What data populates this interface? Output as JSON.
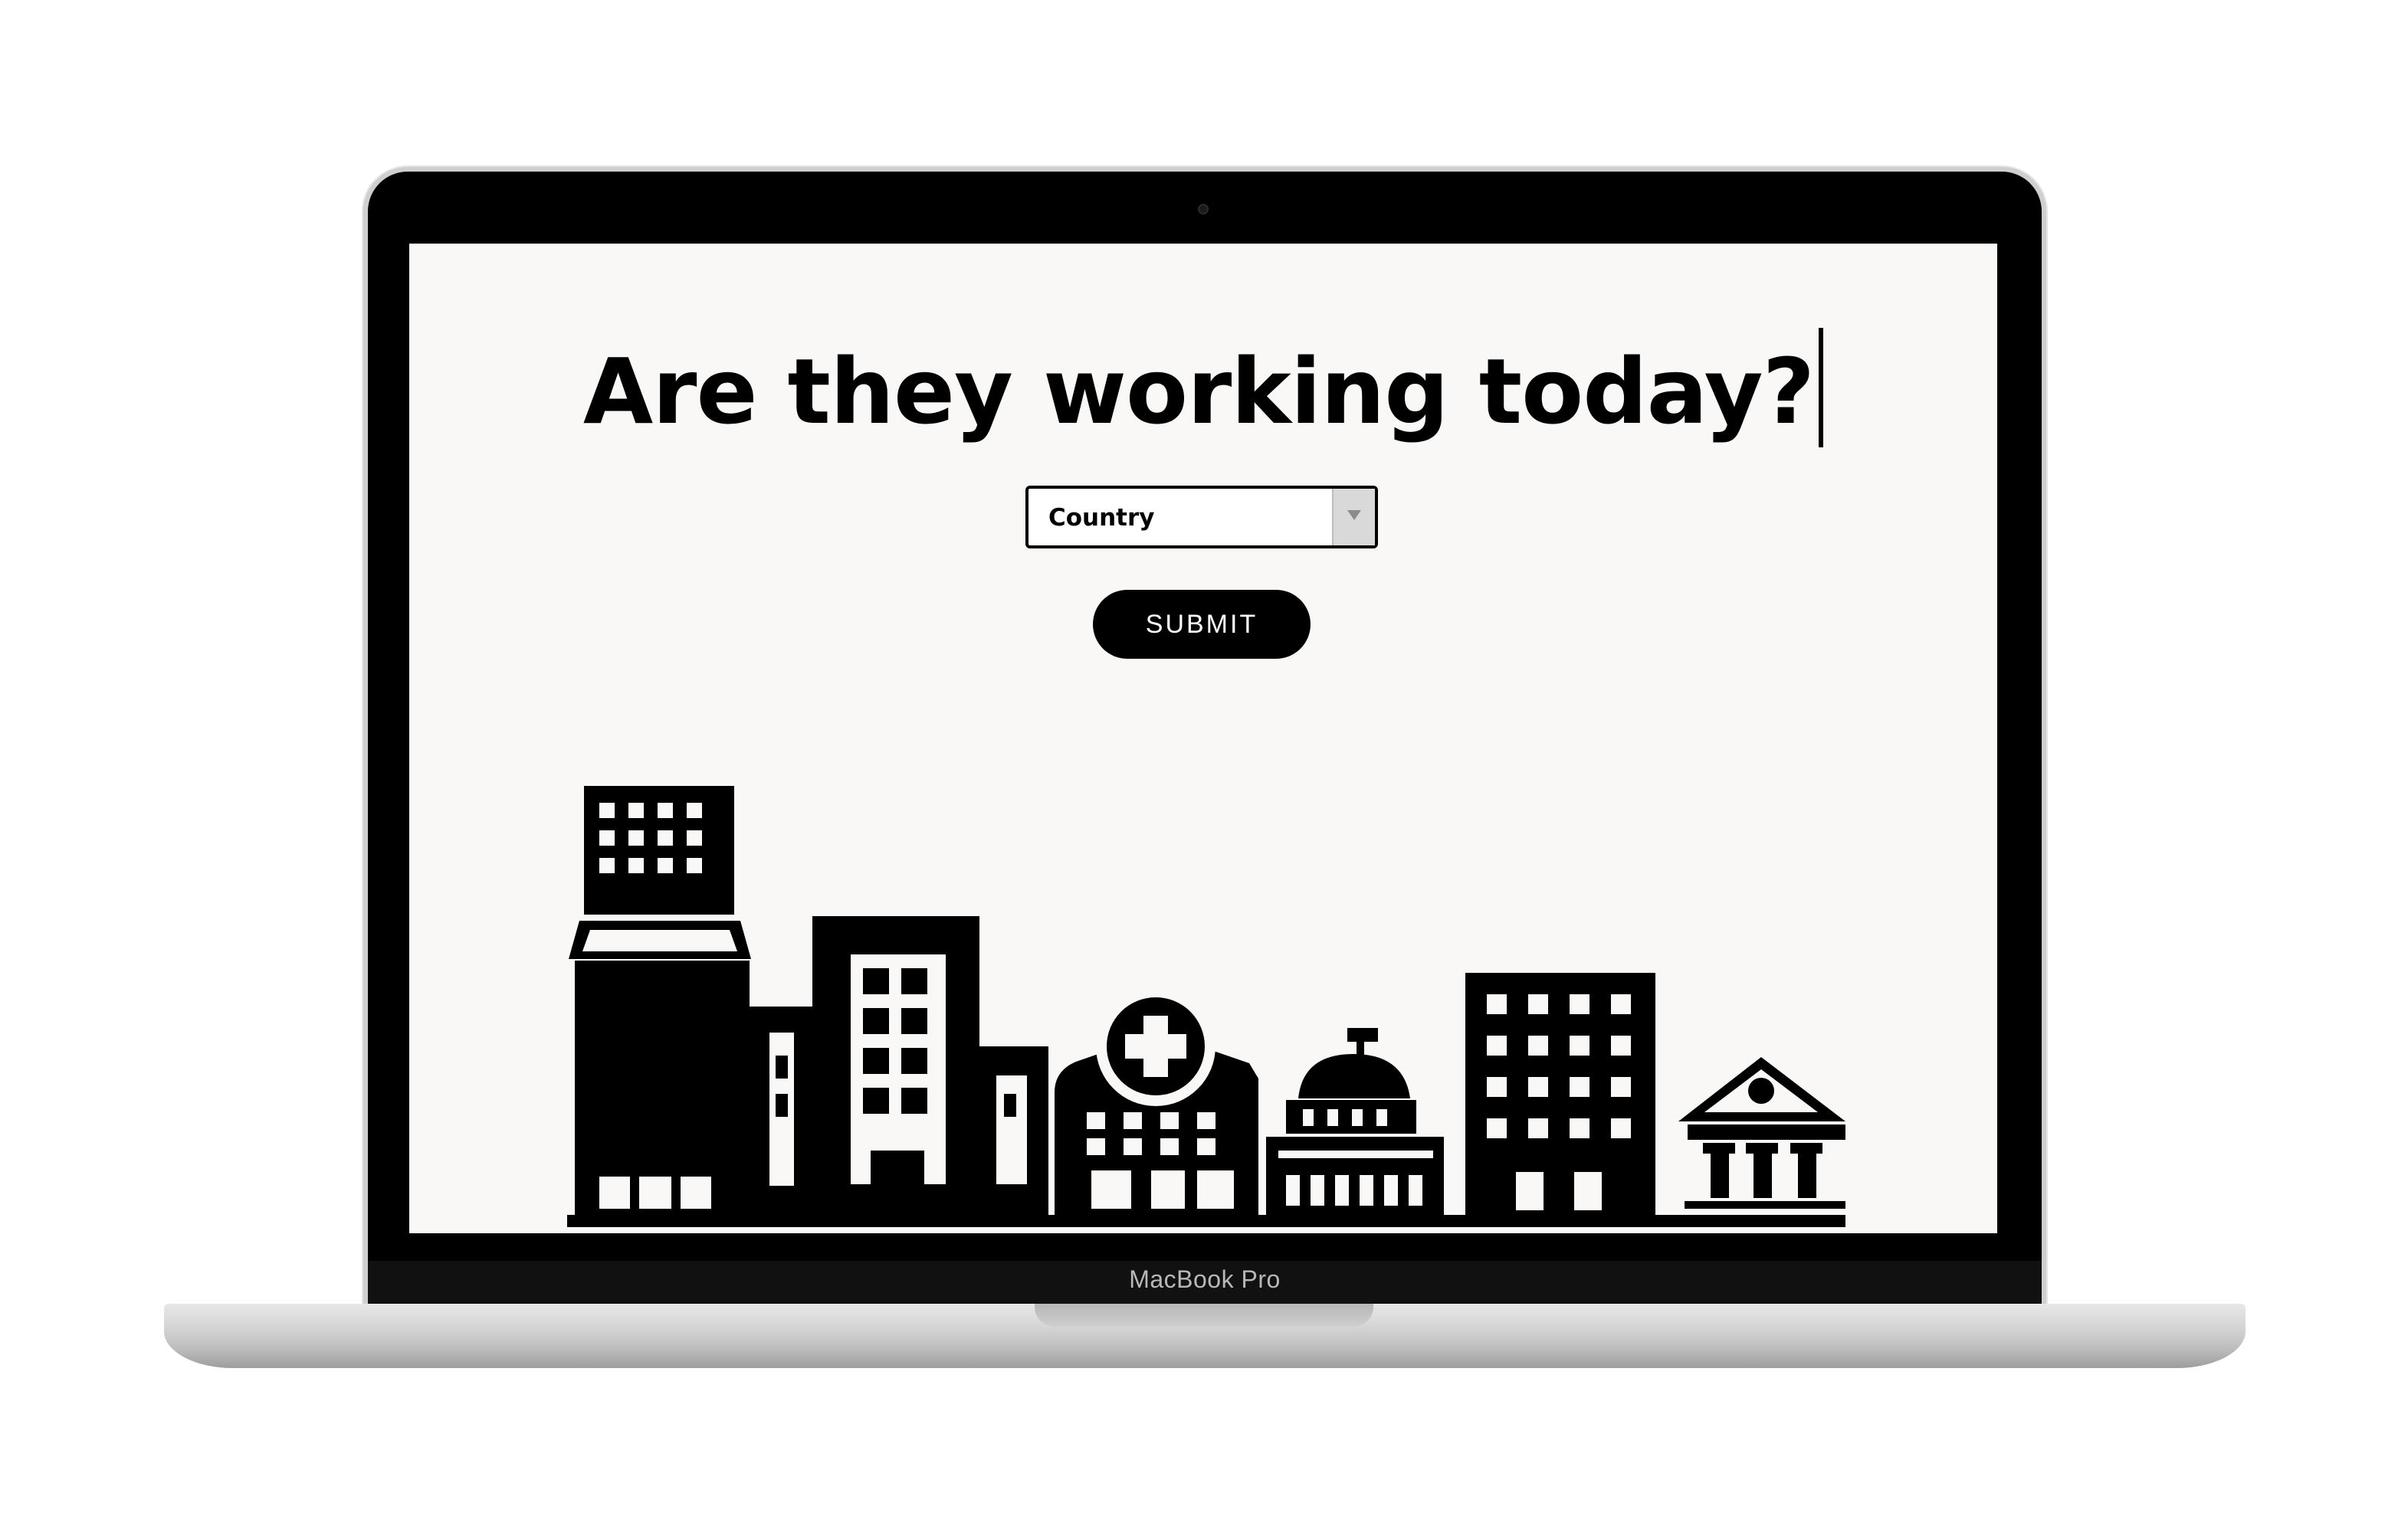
{
  "page": {
    "headline": "Are they working today?",
    "country_select": {
      "selected": "Country"
    },
    "submit_label": "SUBMIT"
  },
  "device": {
    "brand": "MacBook Pro"
  },
  "icons": [
    "hotel-building-icon",
    "office-tower-icon",
    "hospital-icon",
    "capitol-icon",
    "apartment-block-icon",
    "bank-icon"
  ],
  "colors": {
    "screen_background": "#f9f8f6",
    "foreground": "#000000",
    "button_text": "#ffffff"
  }
}
